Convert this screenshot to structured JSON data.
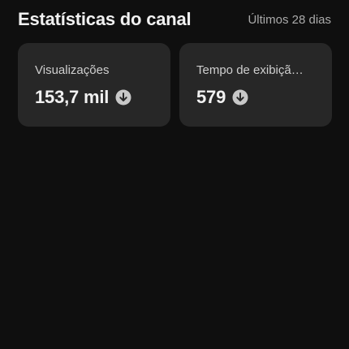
{
  "header": {
    "title": "Estatísticas do canal",
    "period": "Últimos 28 dias"
  },
  "cards": [
    {
      "label": "Visualizações",
      "value": "153,7 mil",
      "trend_icon": "arrow-down-circle-icon"
    },
    {
      "label": "Tempo de exibiçã…",
      "value": "579",
      "trend_icon": "arrow-down-circle-icon"
    }
  ],
  "colors": {
    "background": "#0f0f0f",
    "card": "#272727",
    "text_primary": "#f1f1f1",
    "text_secondary": "#aaaaaa",
    "icon": "#c8c8c8"
  }
}
